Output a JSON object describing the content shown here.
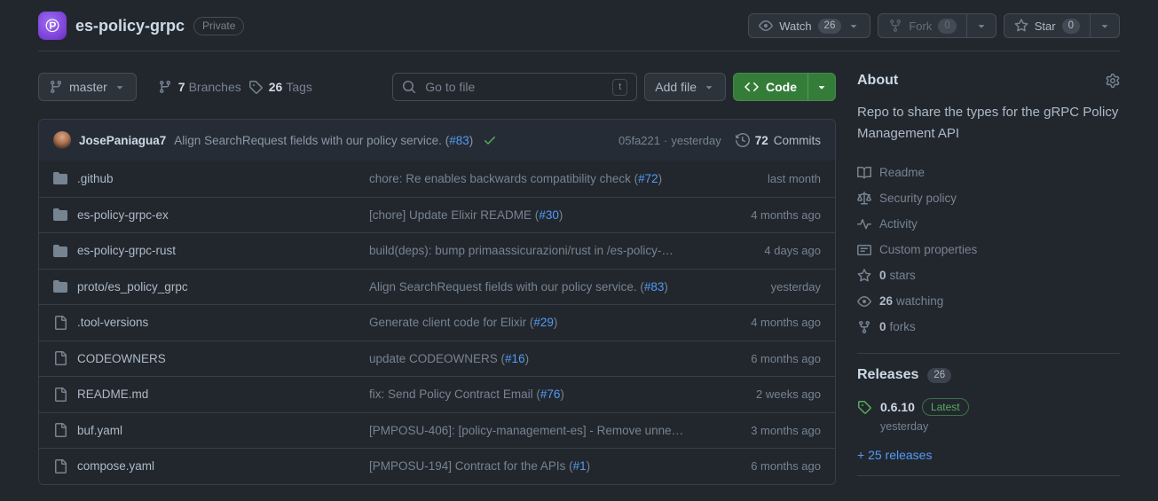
{
  "colors": {
    "page_bg": "#22272e",
    "code_button_green": "#347d39",
    "link_blue": "#539bf5",
    "success_green": "#57ab5a",
    "repo_avatar_purple": "#8a63d2"
  },
  "icons": [
    "p-logo-icon",
    "eye-icon",
    "fork-icon",
    "star-icon",
    "caret-down-icon",
    "git-branch-icon",
    "tag-icon",
    "search-icon",
    "code-icon",
    "history-icon",
    "check-icon",
    "folder-icon",
    "file-icon",
    "book-icon",
    "law-icon",
    "pulse-icon",
    "note-icon",
    "gear-icon"
  ],
  "header": {
    "repo_name": "es-policy-grpc",
    "visibility": "Private",
    "watch": {
      "label": "Watch",
      "count": "26"
    },
    "fork": {
      "label": "Fork",
      "count": "0"
    },
    "star": {
      "label": "Star",
      "count": "0"
    }
  },
  "toolbar": {
    "branch": "master",
    "branches_count": "7",
    "branches_label": "Branches",
    "tags_count": "26",
    "tags_label": "Tags",
    "goto_placeholder": "Go to file",
    "goto_shortcut": "t",
    "add_file": "Add file",
    "code": "Code"
  },
  "commit_bar": {
    "author": "JosePaniagua7",
    "message_prefix": "Align SearchRequest fields with our policy service. (",
    "message_link": "#83",
    "message_suffix": ")",
    "sha": "05fa221",
    "dot": "·",
    "time": "yesterday",
    "history_count": "72",
    "history_label": "Commits"
  },
  "files": [
    {
      "kind": "dir",
      "name": ".github",
      "msg_prefix": "chore: Re enables backwards compatibility check (",
      "msg_link": "#72",
      "msg_suffix": ")",
      "date": "last month"
    },
    {
      "kind": "dir",
      "name": "es-policy-grpc-ex",
      "msg_prefix": "[chore] Update Elixir README (",
      "msg_link": "#30",
      "msg_suffix": ")",
      "date": "4 months ago"
    },
    {
      "kind": "dir",
      "name": "es-policy-grpc-rust",
      "msg_prefix": "build(deps): bump primaassicurazioni/rust in /es-policy-…",
      "msg_link": "",
      "msg_suffix": "",
      "date": "4 days ago"
    },
    {
      "kind": "dir",
      "name": "proto/es_policy_grpc",
      "msg_prefix": "Align SearchRequest fields with our policy service. (",
      "msg_link": "#83",
      "msg_suffix": ")",
      "date": "yesterday"
    },
    {
      "kind": "file",
      "name": ".tool-versions",
      "msg_prefix": "Generate client code for Elixir (",
      "msg_link": "#29",
      "msg_suffix": ")",
      "date": "4 months ago"
    },
    {
      "kind": "file",
      "name": "CODEOWNERS",
      "msg_prefix": "update CODEOWNERS (",
      "msg_link": "#16",
      "msg_suffix": ")",
      "date": "6 months ago"
    },
    {
      "kind": "file",
      "name": "README.md",
      "msg_prefix": "fix: Send Policy Contract Email (",
      "msg_link": "#76",
      "msg_suffix": ")",
      "date": "2 weeks ago"
    },
    {
      "kind": "file",
      "name": "buf.yaml",
      "msg_prefix": "[PMPOSU-406]: [policy-management-es] - Remove unne…",
      "msg_link": "",
      "msg_suffix": "",
      "date": "3 months ago"
    },
    {
      "kind": "file",
      "name": "compose.yaml",
      "msg_prefix": "[PMPOSU-194] Contract for the APIs (",
      "msg_link": "#1",
      "msg_suffix": ")",
      "date": "6 months ago"
    }
  ],
  "sidebar": {
    "about_title": "About",
    "description": "Repo to share the types for the gRPC Policy Management API",
    "links": [
      {
        "count": "",
        "label": "Readme"
      },
      {
        "count": "",
        "label": "Security policy"
      },
      {
        "count": "",
        "label": "Activity"
      },
      {
        "count": "",
        "label": "Custom properties"
      },
      {
        "count": "0",
        "label": "stars"
      },
      {
        "count": "26",
        "label": "watching"
      },
      {
        "count": "0",
        "label": "forks"
      }
    ],
    "releases": {
      "title": "Releases",
      "count": "26",
      "latest_version": "0.6.10",
      "latest_badge": "Latest",
      "latest_time": "yesterday",
      "more_link": "+ 25 releases"
    }
  }
}
